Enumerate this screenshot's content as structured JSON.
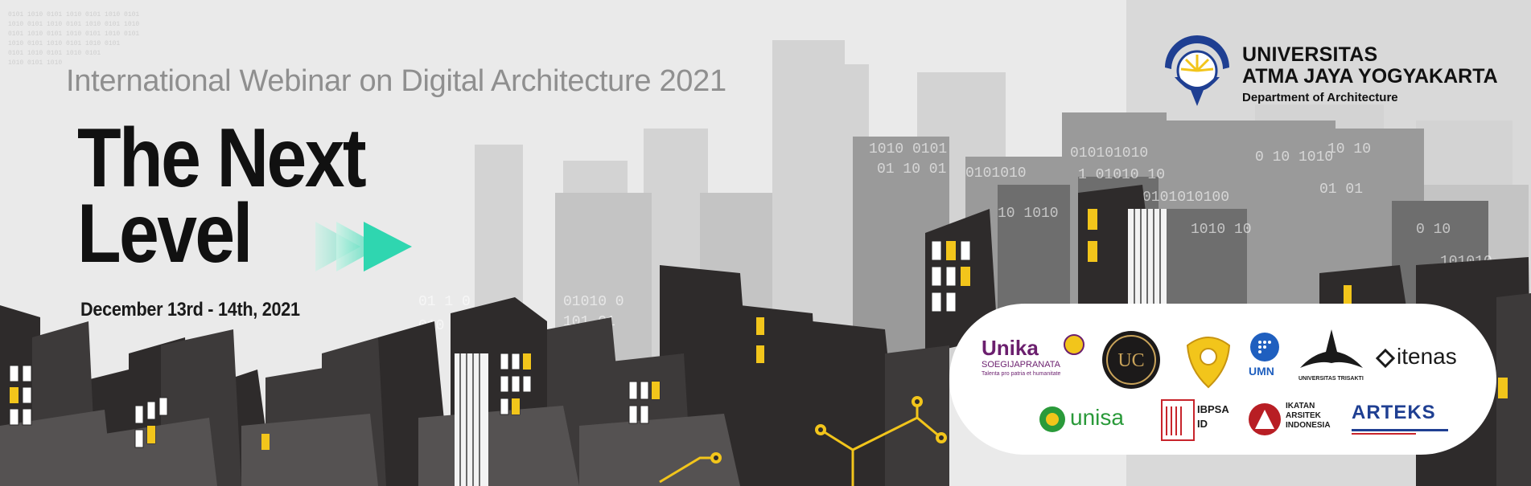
{
  "pre_title": "International Webinar on Digital Architecture 2021",
  "main_title": {
    "line1": "The Next",
    "line2": "Level"
  },
  "date": "December 13rd - 14th, 2021",
  "university": {
    "line1": "UNIVERSITAS",
    "line2": "ATMA JAYA YOGYAKARTA",
    "line3": "Department of Architecture"
  },
  "partners": {
    "unika": {
      "name": "Unika",
      "sub": "SOEGIJAPRANATA",
      "tagline": "Talenta pro patria et humanitate"
    },
    "uc": {
      "name": "UC"
    },
    "umn": {
      "name": "UMN"
    },
    "trisakti": {
      "name": "UNIVERSITAS TRISAKTI"
    },
    "itenas": {
      "name": "itenas"
    },
    "unisa": {
      "name": "unisa"
    },
    "ibpsa": {
      "line1": "IBPSA",
      "line2": "ID"
    },
    "iai": {
      "line1": "IKATAN",
      "line2": "ARSITEK",
      "line3": "INDONESIA"
    },
    "arteks": {
      "name": "ARTEKS"
    }
  },
  "colors": {
    "accent_teal": "#2fd6b0",
    "window_yellow": "#f2c51b",
    "building_dark": "#2b2828",
    "circuit_yellow": "#f2c51b"
  }
}
